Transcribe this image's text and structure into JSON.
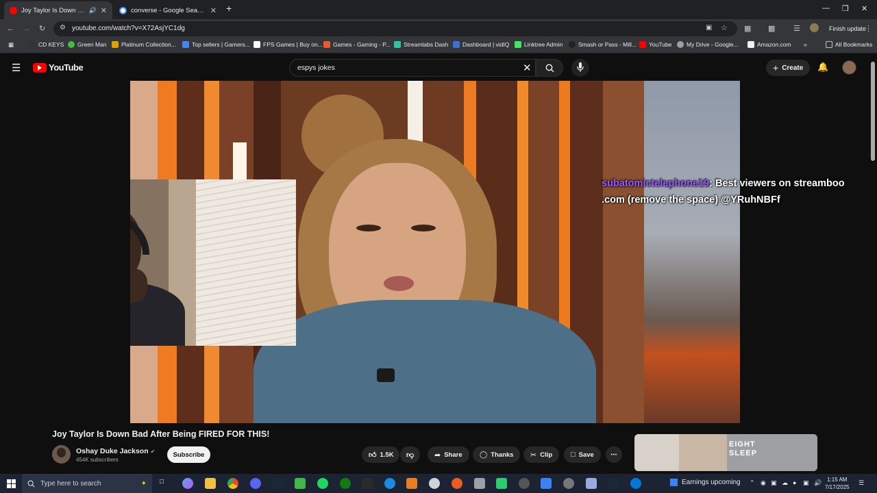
{
  "browser": {
    "tabs": [
      {
        "title": "Joy Taylor Is Down Bad Afte",
        "active": true
      },
      {
        "title": "converse - Google Search",
        "active": false
      }
    ],
    "url": "youtube.com/watch?v=X72AsjYC1dg",
    "finish_update": "Finish update",
    "bookmarks": [
      "CD KEYS",
      "Green Man",
      "Platinum Collection...",
      "Top sellers | Gamers...",
      "FPS Games | Buy on...",
      "Games - Gaming - P...",
      "Streamlabs Dash",
      "Dashboard | vidIQ",
      "Linktree Admin",
      "Smash or Pass - Mill...",
      "YouTube",
      "My Drive - Google...",
      "Amazon.com"
    ],
    "all_bookmarks": "All Bookmarks"
  },
  "youtube": {
    "logo_text": "YouTube",
    "search_value": "espys jokes",
    "create_label": "Create",
    "video": {
      "chat_user": "subatomictelephone19",
      "chat_message": ": Best viewers on streamboo .com (remove the space) @YRuhNBFf"
    },
    "title": "Joy Taylor Is Down Bad After Being FIRED FOR THIS!",
    "channel_name": "Oshay Duke Jackson",
    "subscribers": "454K subscribers",
    "subscribe_label": "Subscribe",
    "likes": "1.5K",
    "share_label": "Share",
    "thanks_label": "Thanks",
    "clip_label": "Clip",
    "save_label": "Save",
    "ad_text": "EIGHT SLEEP"
  },
  "taskbar": {
    "search_placeholder": "Type here to search",
    "earnings": "Earnings upcoming",
    "time": "1:15 AM",
    "date": "7/17/2025"
  },
  "colors": {
    "youtube_red": "#ff0000",
    "chat_user": "#9b59ff",
    "background": "#0f0f0f"
  }
}
